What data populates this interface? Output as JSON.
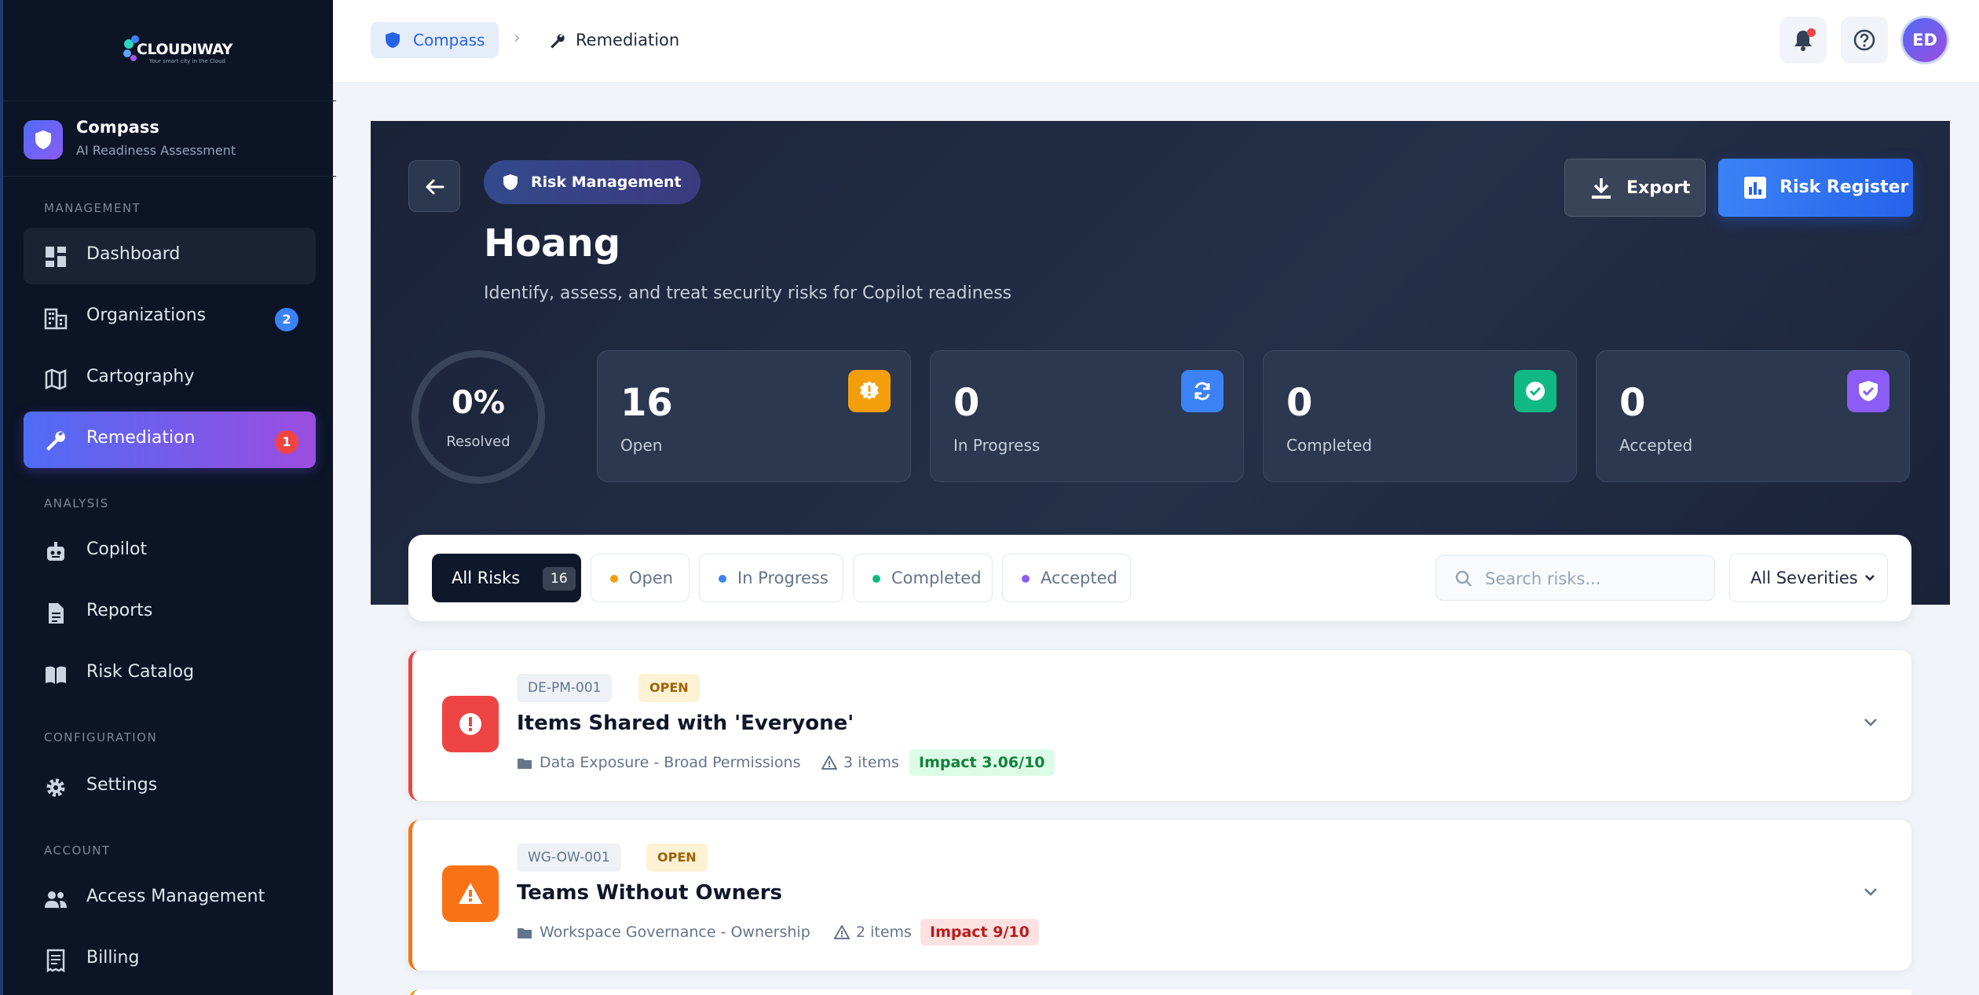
{
  "brand": {
    "name": "CLOUDIWAY",
    "tagline": "Your smart city in the Cloud"
  },
  "app": {
    "name": "Compass",
    "subtitle": "AI Readiness Assessment"
  },
  "sidebar": {
    "sections": {
      "management": "MANAGEMENT",
      "analysis": "ANALYSIS",
      "configuration": "CONFIGURATION",
      "account": "ACCOUNT"
    },
    "items": {
      "dashboard": {
        "label": "Dashboard",
        "icon": "dashboard-icon"
      },
      "organizations": {
        "label": "Organizations",
        "count": "2",
        "icon": "building-icon"
      },
      "cartography": {
        "label": "Cartography",
        "icon": "map-icon"
      },
      "remediation": {
        "label": "Remediation",
        "count": "1",
        "icon": "wrench-icon",
        "active": true
      },
      "copilot": {
        "label": "Copilot",
        "icon": "robot-icon"
      },
      "reports": {
        "label": "Reports",
        "icon": "document-icon"
      },
      "risk_catalog": {
        "label": "Risk Catalog",
        "icon": "book-icon"
      },
      "settings": {
        "label": "Settings",
        "icon": "gear-icon"
      },
      "access_management": {
        "label": "Access Management",
        "icon": "people-icon"
      },
      "billing": {
        "label": "Billing",
        "icon": "receipt-icon"
      }
    }
  },
  "breadcrumb": {
    "root": "Compass",
    "current": "Remediation"
  },
  "user": {
    "initials": "ED"
  },
  "hero": {
    "badge": "Risk Management",
    "title": "Hoang",
    "subtitle": "Identify, assess, and treat security risks for Copilot readiness",
    "export_label": "Export",
    "register_label": "Risk Register",
    "resolved_pct": "0%",
    "resolved_label": "Resolved",
    "stats": [
      {
        "value": "16",
        "label": "Open",
        "color": "#f59e0b",
        "icon": "alert-badge-icon"
      },
      {
        "value": "0",
        "label": "In Progress",
        "color": "#3b82f6",
        "icon": "refresh-icon"
      },
      {
        "value": "0",
        "label": "Completed",
        "color": "#10b981",
        "icon": "check-circle-icon"
      },
      {
        "value": "0",
        "label": "Accepted",
        "color": "#8b5cf6",
        "icon": "shield-check-icon"
      }
    ]
  },
  "filters": {
    "all_label": "All Risks",
    "all_count": "16",
    "chips": [
      {
        "label": "Open",
        "color": "#f59e0b"
      },
      {
        "label": "In Progress",
        "color": "#3b82f6"
      },
      {
        "label": "Completed",
        "color": "#10b981"
      },
      {
        "label": "Accepted",
        "color": "#8b5cf6"
      }
    ],
    "search_placeholder": "Search risks...",
    "severity_selected": "All Severities"
  },
  "risks": [
    {
      "code": "DE-PM-001",
      "status": "OPEN",
      "title": "Items Shared with 'Everyone'",
      "category": "Data Exposure - Broad Permissions",
      "items": "3 items",
      "impact": "Impact 3.06/10",
      "accent": "#ef4444",
      "impact_bg": "#dcfce7",
      "impact_color": "#15803d"
    },
    {
      "code": "WG-OW-001",
      "status": "OPEN",
      "title": "Teams Without Owners",
      "category": "Workspace Governance - Ownership",
      "items": "2 items",
      "impact": "Impact 9/10",
      "accent": "#f97316",
      "impact_bg": "#fee2e2",
      "impact_color": "#b91c1c"
    }
  ]
}
